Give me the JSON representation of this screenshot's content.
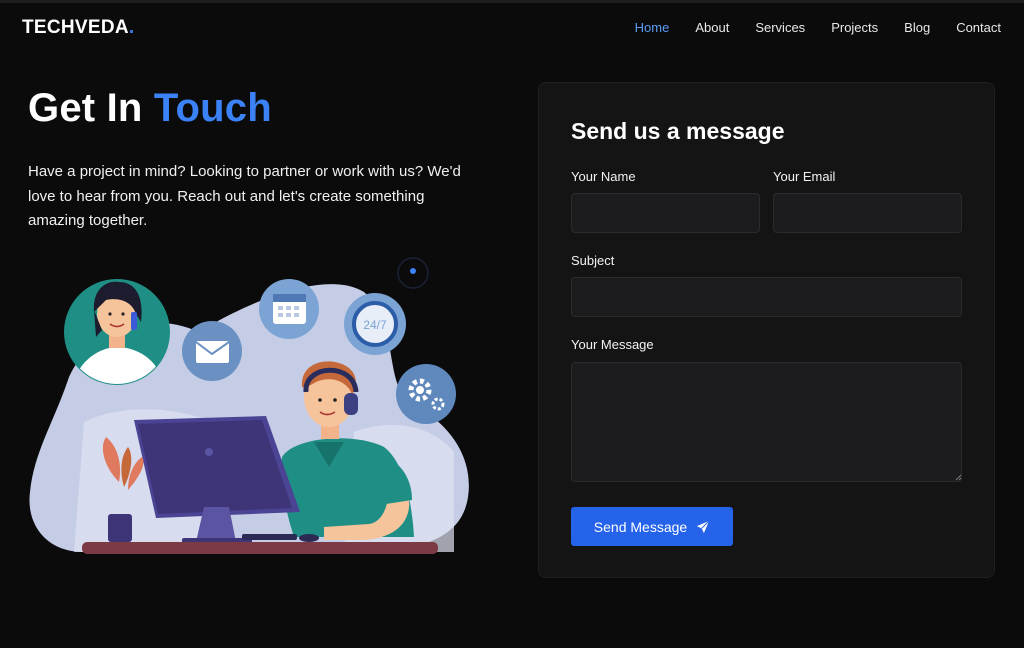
{
  "brand": {
    "name": "TECHVEDA",
    "dot": "."
  },
  "nav": {
    "items": [
      {
        "label": "Home",
        "active": true
      },
      {
        "label": "About"
      },
      {
        "label": "Services"
      },
      {
        "label": "Projects"
      },
      {
        "label": "Blog"
      },
      {
        "label": "Contact"
      }
    ]
  },
  "hero": {
    "title_main": "Get In ",
    "title_accent": "Touch",
    "description": "Have a project in mind? Looking to partner or work with us? We'd love to hear from you. Reach out and let's create something amazing together."
  },
  "illustration": {
    "clock_text": "24/7",
    "icons": [
      "person-on-phone",
      "mail-icon",
      "calendar-icon",
      "clock-24-7-icon",
      "gears-icon",
      "man-at-computer"
    ]
  },
  "form": {
    "title": "Send us a message",
    "name_label": "Your Name",
    "name_value": "",
    "email_label": "Your Email",
    "email_value": "",
    "subject_label": "Subject",
    "subject_value": "",
    "message_label": "Your Message",
    "message_value": "",
    "submit_label": "Send Message",
    "submit_icon": "paper-plane-icon"
  },
  "colors": {
    "background": "#0b0b0c",
    "accent": "#3b82f6",
    "button": "#2563eb",
    "card": "#141415",
    "field": "#1c1c1e",
    "nav_active": "#5b9cf6"
  }
}
